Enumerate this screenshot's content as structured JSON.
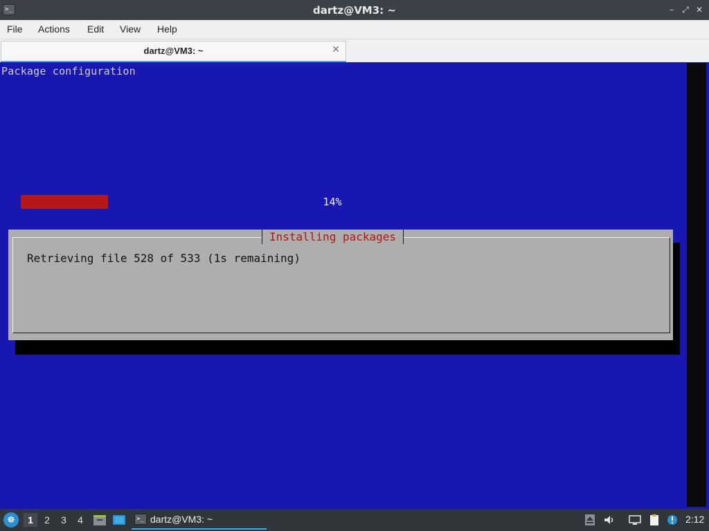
{
  "window": {
    "title": "dartz@VM3: ~",
    "app_icon_glyph": ">_",
    "controls": {
      "minimize": "–",
      "maximize": "⤢",
      "close": "✕"
    }
  },
  "menubar": {
    "items": [
      "File",
      "Actions",
      "Edit",
      "View",
      "Help"
    ]
  },
  "tabs": [
    {
      "label": "dartz@VM3: ~",
      "close_glyph": "✕",
      "active": true
    }
  ],
  "terminal": {
    "heading": "Package configuration",
    "background": "#1818b0",
    "dialog": {
      "title": "Installing packages",
      "message": "Retrieving file 528 of 533 (1s remaining)",
      "progress": {
        "percent": 14,
        "label": "14%"
      },
      "title_color": "#b01515",
      "bar_fill_color": "#b51818"
    }
  },
  "taskbar": {
    "menu_glyph": "☸",
    "workspaces": [
      "1",
      "2",
      "3",
      "4"
    ],
    "active_workspace": "1",
    "quicklaunch": [
      "file-manager-icon",
      "desktop-icon"
    ],
    "task": {
      "label": "dartz@VM3: ~",
      "icon_glyph": ">_"
    },
    "tray": [
      "eject-icon",
      "volume-icon",
      "network-icon",
      "clipboard-icon",
      "update-notifier-icon"
    ],
    "clock": "2:12",
    "accent": "#3daee9"
  }
}
